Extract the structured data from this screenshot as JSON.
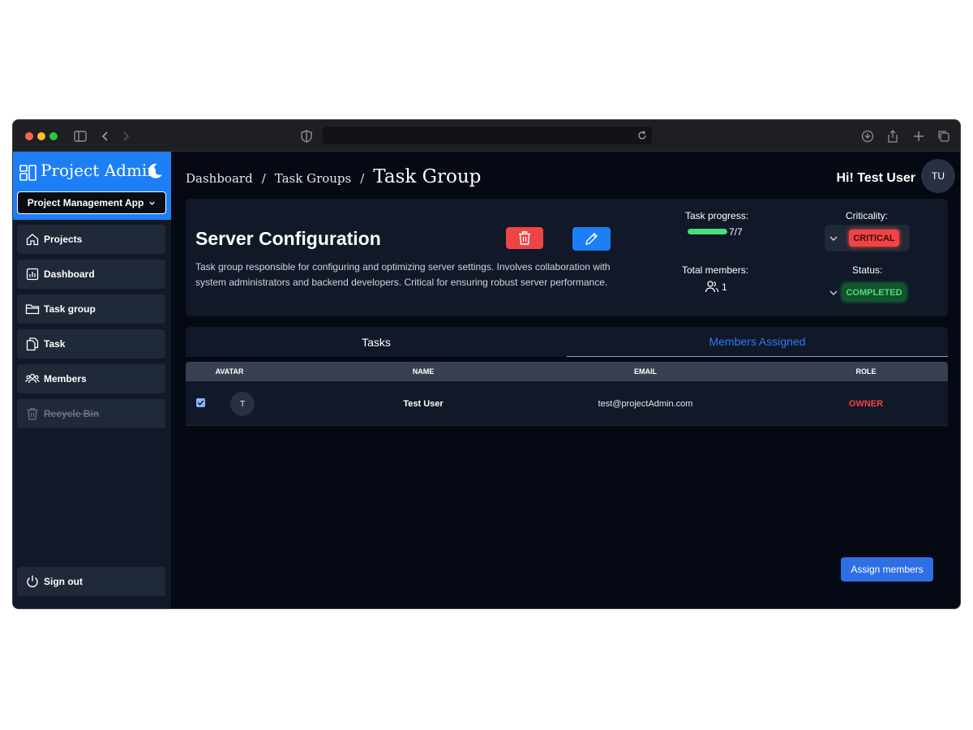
{
  "browser": {
    "url": ""
  },
  "sidebar": {
    "brand": "Project Admin",
    "app_select": "Project Management App",
    "items": [
      {
        "label": "Projects",
        "icon": "home-icon"
      },
      {
        "label": "Dashboard",
        "icon": "chart-icon"
      },
      {
        "label": "Task group",
        "icon": "folder-icon"
      },
      {
        "label": "Task",
        "icon": "copy-icon"
      },
      {
        "label": "Members",
        "icon": "users-icon"
      },
      {
        "label": "Recycle Bin",
        "icon": "trash-icon",
        "disabled": true
      }
    ],
    "sign_out": "Sign out"
  },
  "header": {
    "breadcrumb": [
      "Dashboard",
      "Task Groups",
      "Task Group"
    ],
    "greeting": "Hi! Test User",
    "avatar": "TU"
  },
  "task_group": {
    "title": "Server Configuration",
    "description": "Task group responsible for configuring and optimizing server settings. Involves collaboration with system administrators and backend developers. Critical for ensuring robust server performance.",
    "progress_label": "Task progress:",
    "progress_text": "7/7",
    "progress_fraction": 1.0,
    "members_label": "Total members:",
    "members_count": "1",
    "criticality_label": "Criticality:",
    "criticality": "CRITICAL",
    "status_label": "Status:",
    "status": "COMPLETED",
    "colors": {
      "critical": "#ef4444",
      "completed": "#22c55e",
      "accent": "#1d7ff5"
    }
  },
  "tabs": [
    {
      "label": "Tasks",
      "active": false
    },
    {
      "label": "Members Assigned",
      "active": true
    }
  ],
  "members_table": {
    "headers": [
      "AVATAR",
      "NAME",
      "EMAIL",
      "ROLE"
    ],
    "rows": [
      {
        "checked": true,
        "avatar": "T",
        "name": "Test User",
        "email": "test@projectAdmin.com",
        "role": "OWNER"
      }
    ]
  },
  "assign_button": "Assign members"
}
